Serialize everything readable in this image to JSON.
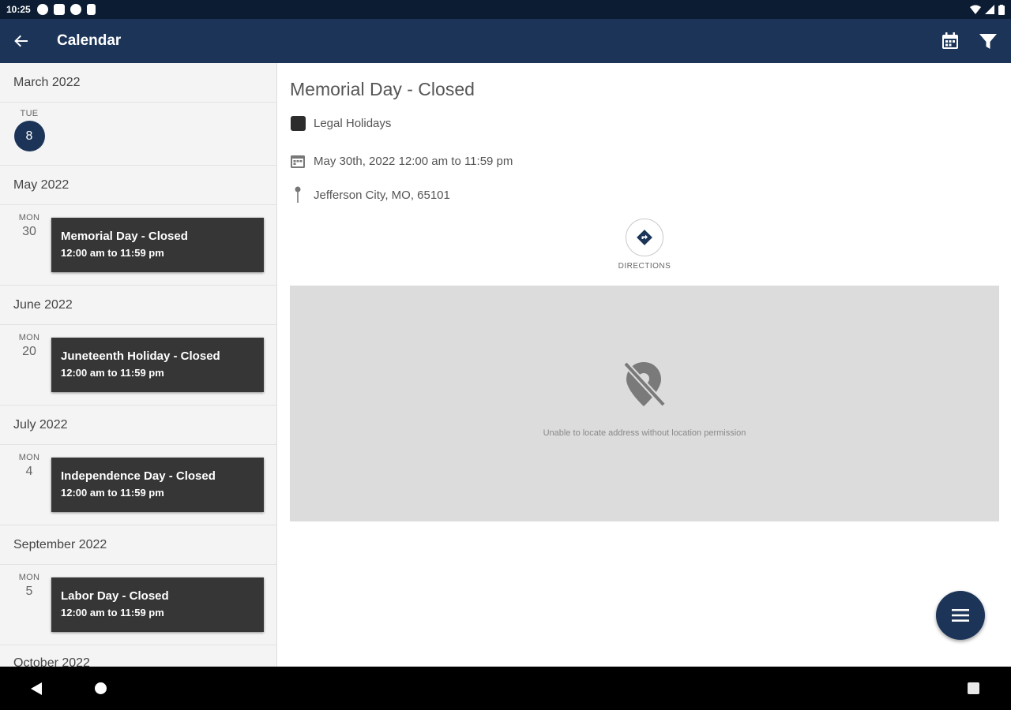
{
  "status_bar": {
    "time": "10:25"
  },
  "app_bar": {
    "title": "Calendar"
  },
  "event_list": {
    "groups": [
      {
        "month": "March 2022",
        "day_of_week": "TUE",
        "day": "8",
        "today": true
      },
      {
        "month": "May 2022",
        "day_of_week": "MON",
        "day": "30",
        "event_title": "Memorial Day - Closed",
        "event_time": "12:00 am to 11:59 pm"
      },
      {
        "month": "June 2022",
        "day_of_week": "MON",
        "day": "20",
        "event_title": "Juneteenth Holiday - Closed",
        "event_time": "12:00 am to 11:59 pm"
      },
      {
        "month": "July 2022",
        "day_of_week": "MON",
        "day": "4",
        "event_title": "Independence Day - Closed",
        "event_time": "12:00 am to 11:59 pm"
      },
      {
        "month": "September 2022",
        "day_of_week": "MON",
        "day": "5",
        "event_title": "Labor Day - Closed",
        "event_time": "12:00 am to 11:59 pm"
      }
    ],
    "partial_next_month": "October 2022"
  },
  "detail": {
    "title": "Memorial Day - Closed",
    "category": "Legal Holidays",
    "datetime": "May 30th, 2022 12:00 am to 11:59 pm",
    "location": "Jefferson City, MO, 65101",
    "directions_label": "DIRECTIONS",
    "map_message": "Unable to locate address without location permission"
  },
  "colors": {
    "app_bar": "#1b3458",
    "status_bar": "#0c1d33",
    "event_card": "#363636",
    "accent": "#1b3458"
  },
  "icons": {
    "back": "arrow-left-icon",
    "calendar": "calendar-icon",
    "filter": "filter-icon",
    "directions": "directions-icon",
    "location_off": "location-off-icon",
    "menu": "menu-icon"
  }
}
